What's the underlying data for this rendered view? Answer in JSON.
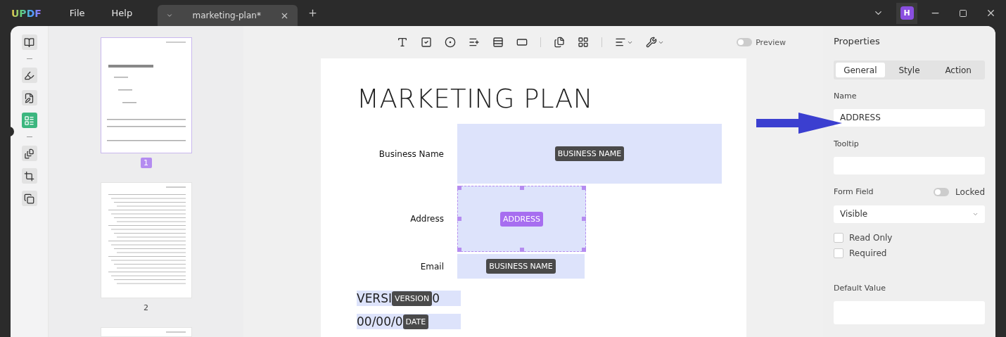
{
  "app": {
    "logo": "UPDF",
    "menu": [
      "File",
      "Help"
    ],
    "tabs": [
      {
        "title": "marketing-plan*",
        "selected": true
      }
    ],
    "avatar": "H"
  },
  "rail": [
    {
      "kind": "tool",
      "selected": false
    },
    {
      "kind": "divider"
    },
    {
      "kind": "tool",
      "selected": false
    },
    {
      "kind": "tool",
      "selected": false
    },
    {
      "kind": "tool",
      "selected": true
    },
    {
      "kind": "divider"
    },
    {
      "kind": "tool",
      "selected": false
    },
    {
      "kind": "tool",
      "selected": false
    },
    {
      "kind": "tool",
      "selected": false
    }
  ],
  "thumbnails": [
    {
      "label": "1",
      "selected": true,
      "kind": "cover"
    },
    {
      "label": "2",
      "selected": false,
      "kind": "toc"
    },
    {
      "kind": "partial"
    }
  ],
  "toolbar": {
    "preview": {
      "label": "Preview",
      "on": false
    }
  },
  "document": {
    "title": "MARKETING PLAN",
    "fields": [
      {
        "label": "Business Name",
        "badge": "BUSINESS NAME",
        "selected": false
      },
      {
        "label": "Address",
        "badge": "ADDRESS",
        "selected": true
      },
      {
        "label": "Email",
        "badge": "BUSINESS NAME",
        "selected": false
      }
    ],
    "inline_fields": [
      {
        "before": "VERSI",
        "badge": "VERSION",
        "after": "0"
      },
      {
        "before": "00/00/0",
        "badge": "DATE"
      }
    ]
  },
  "properties": {
    "title": "Properties",
    "tabs": [
      {
        "label": "General",
        "selected": true
      },
      {
        "label": "Style",
        "selected": false
      },
      {
        "label": "Action",
        "selected": false
      }
    ],
    "name": {
      "label": "Name",
      "value": "ADDRESS"
    },
    "tooltip": {
      "label": "Tooltip"
    },
    "form_field": {
      "label": "Form Field",
      "locked": {
        "label": "Locked",
        "on": false
      },
      "visibility": "Visible"
    },
    "checks": [
      {
        "label": "Read Only",
        "checked": false
      },
      {
        "label": "Required",
        "checked": false
      }
    ],
    "default_value": {
      "label": "Default Value"
    }
  }
}
